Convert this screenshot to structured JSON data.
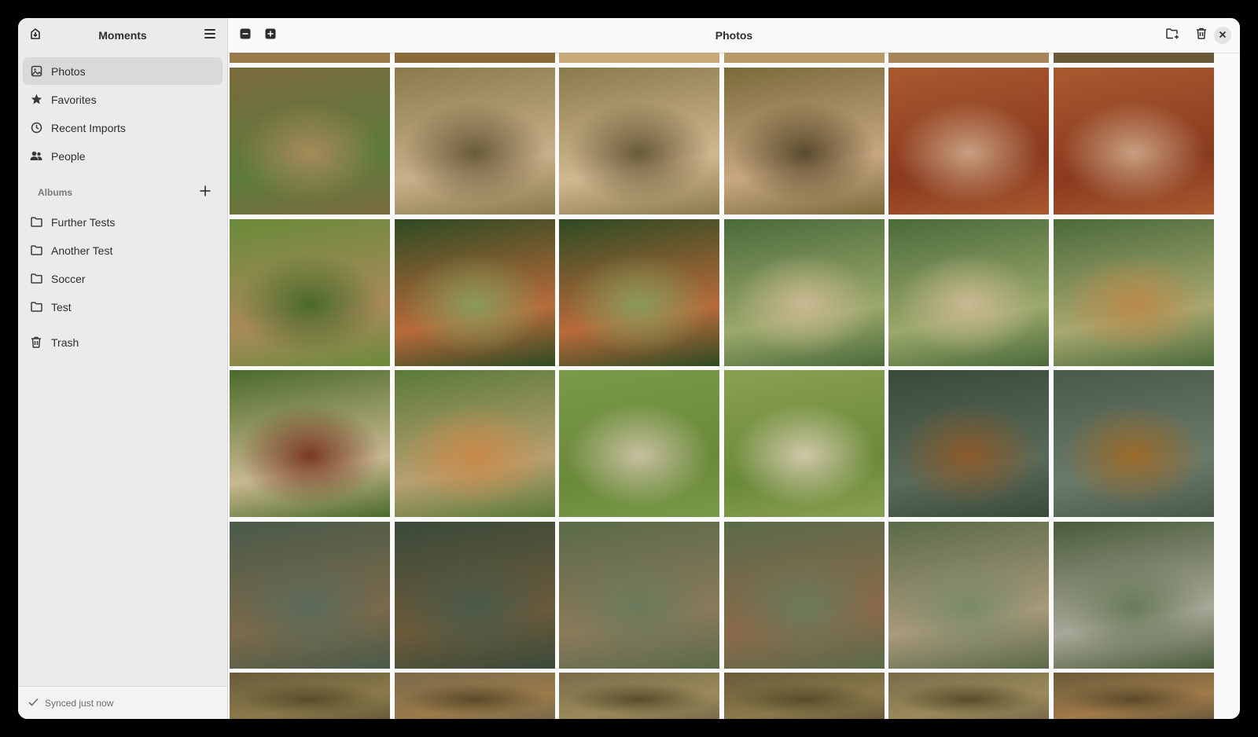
{
  "sidebar": {
    "title": "Moments",
    "nav": [
      {
        "label": "Photos",
        "icon": "image-icon",
        "active": true
      },
      {
        "label": "Favorites",
        "icon": "star-icon",
        "active": false
      },
      {
        "label": "Recent Imports",
        "icon": "clock-icon",
        "active": false
      },
      {
        "label": "People",
        "icon": "people-icon",
        "active": false
      }
    ],
    "albums_label": "Albums",
    "albums": [
      {
        "label": "Further Tests",
        "icon": "folder-icon"
      },
      {
        "label": "Another Test",
        "icon": "folder-icon"
      },
      {
        "label": "Soccer",
        "icon": "folder-icon"
      },
      {
        "label": "Test",
        "icon": "folder-icon"
      }
    ],
    "trash_label": "Trash",
    "footer_status": "Synced just now"
  },
  "main": {
    "title": "Photos"
  },
  "photo_rows": [
    [
      {
        "subject": "meerkat on plant",
        "colors": [
          "#7a6a3c",
          "#5c7a3a",
          "#a68a5a"
        ]
      },
      {
        "subject": "meerkat on log",
        "colors": [
          "#8a7a4a",
          "#c8b08a",
          "#6a5a3a"
        ]
      },
      {
        "subject": "meerkat on log",
        "colors": [
          "#8a7a4a",
          "#d0b890",
          "#6a5a3a"
        ]
      },
      {
        "subject": "meerkat on log",
        "colors": [
          "#7a6a3a",
          "#c8a880",
          "#5a4a2e"
        ]
      },
      {
        "subject": "meerkat on rock",
        "colors": [
          "#a85a30",
          "#8a3a1e",
          "#c8a080"
        ]
      },
      {
        "subject": "meerkat on rock",
        "colors": [
          "#a85a30",
          "#8a3a1e",
          "#c8a080"
        ]
      }
    ],
    [
      {
        "subject": "garden bench",
        "colors": [
          "#6a8a3a",
          "#a88a5a",
          "#4a6a2a"
        ]
      },
      {
        "subject": "capybaras",
        "colors": [
          "#2e4a22",
          "#b86a3a",
          "#8a9a5a"
        ]
      },
      {
        "subject": "capybaras",
        "colors": [
          "#2e4a22",
          "#b86a3a",
          "#8a9a5a"
        ]
      },
      {
        "subject": "giraffe",
        "colors": [
          "#4a6a3a",
          "#9aa86a",
          "#c8b890"
        ]
      },
      {
        "subject": "giraffe",
        "colors": [
          "#4a6a3a",
          "#9aa86a",
          "#c8b890"
        ]
      },
      {
        "subject": "giraffes",
        "colors": [
          "#4a6a3a",
          "#a8a870",
          "#b88a4a"
        ]
      }
    ],
    [
      {
        "subject": "enclosure",
        "colors": [
          "#4a6a2a",
          "#c8b890",
          "#7a3a22"
        ]
      },
      {
        "subject": "giraffe lying",
        "colors": [
          "#5a7a3a",
          "#b8a070",
          "#c88a4a"
        ]
      },
      {
        "subject": "zebra",
        "colors": [
          "#7a9a4a",
          "#6a8a3a",
          "#c8c0a0"
        ]
      },
      {
        "subject": "zebra",
        "colors": [
          "#8aa050",
          "#6a8a3a",
          "#d0c8a8"
        ]
      },
      {
        "subject": "tiger in water",
        "colors": [
          "#3a4a3a",
          "#5a6a5a",
          "#8a5a2a"
        ]
      },
      {
        "subject": "tiger in water",
        "colors": [
          "#4a5a4a",
          "#6a7a6a",
          "#9a6a2a"
        ]
      }
    ],
    [
      {
        "subject": "tiger in water",
        "colors": [
          "#4a5a4a",
          "#7a6a4a",
          "#5a6a5a"
        ]
      },
      {
        "subject": "tiger in water",
        "colors": [
          "#3a4a3a",
          "#6a5a3a",
          "#4a5a4a"
        ]
      },
      {
        "subject": "tiger in water",
        "colors": [
          "#5a6a4a",
          "#8a7a5a",
          "#6a7a5a"
        ]
      },
      {
        "subject": "tiger in water",
        "colors": [
          "#5a6a4a",
          "#8a6a4a",
          "#6a7a5a"
        ]
      },
      {
        "subject": "tiger splashing",
        "colors": [
          "#5a6a4a",
          "#a89a7a",
          "#7a8a6a"
        ]
      },
      {
        "subject": "tiger splashing",
        "colors": [
          "#4a5a3a",
          "#a8a898",
          "#6a7a5a"
        ]
      }
    ],
    [
      {
        "subject": "tiger",
        "colors": [
          "#6a5a3a",
          "#8a7a4a",
          "#5a4a2a"
        ]
      },
      {
        "subject": "tiger",
        "colors": [
          "#7a6a4a",
          "#9a7a4a",
          "#5a4a2a"
        ]
      },
      {
        "subject": "tiger",
        "colors": [
          "#7a6a4a",
          "#9a8a5a",
          "#5a4a2a"
        ]
      },
      {
        "subject": "tiger",
        "colors": [
          "#6a5a3a",
          "#8a7a4a",
          "#5a4a2a"
        ]
      },
      {
        "subject": "tiger",
        "colors": [
          "#7a6a4a",
          "#9a8a5a",
          "#5a4a2a"
        ]
      },
      {
        "subject": "tiger",
        "colors": [
          "#6a5a3a",
          "#a07a4a",
          "#5a4a2a"
        ]
      }
    ]
  ],
  "top_partial_row_colors": [
    "#9a7a4a",
    "#8a6a3a",
    "#c8a878",
    "#b89a6a",
    "#a8845a",
    "#6a5a3a"
  ]
}
